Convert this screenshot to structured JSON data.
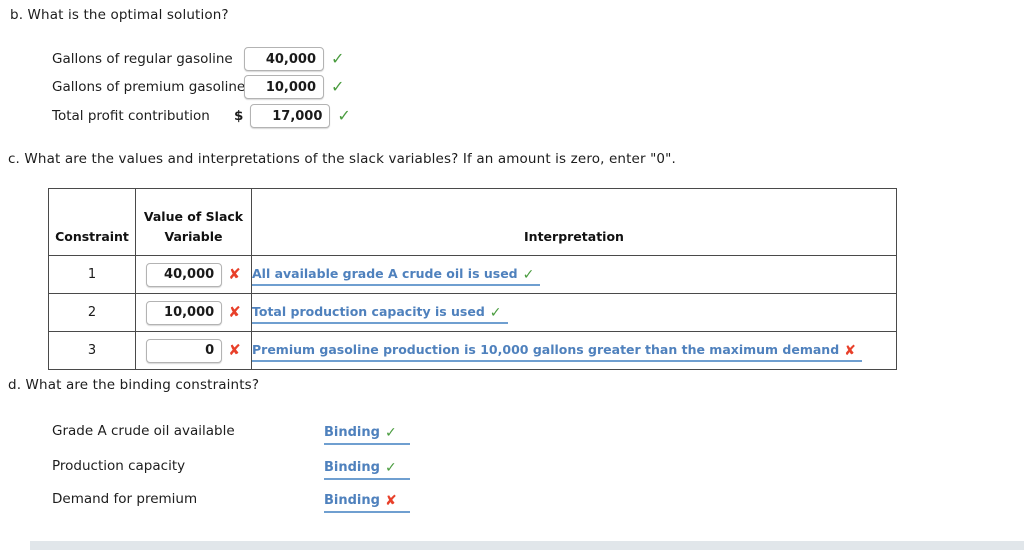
{
  "part_b": {
    "question": "b. What is the optimal solution?",
    "rows": [
      {
        "label": "Gallons of regular gasoline",
        "prefix": "",
        "value": "40,000",
        "mark": "✓",
        "mark_state": "ok"
      },
      {
        "label": "Gallons of premium gasoline",
        "prefix": "",
        "value": "10,000",
        "mark": "✓",
        "mark_state": "ok"
      },
      {
        "label": "Total profit contribution",
        "prefix": "$",
        "value": "17,000",
        "mark": "✓",
        "mark_state": "ok"
      }
    ]
  },
  "part_c": {
    "question": "c. What are the values and interpretations of the slack variables? If an amount is zero, enter \"0\".",
    "table": {
      "headers": {
        "constraint": "Constraint",
        "slack_line1": "Value of Slack",
        "slack_line2": "Variable",
        "interpretation": "Interpretation"
      },
      "rows": [
        {
          "constraint": "1",
          "slack_value": "40,000",
          "slack_mark": "✘",
          "slack_mark_state": "bad",
          "interpretation": "All available grade A crude oil is used",
          "interp_mark": "✓",
          "interp_mark_state": "ok"
        },
        {
          "constraint": "2",
          "slack_value": "10,000",
          "slack_mark": "✘",
          "slack_mark_state": "bad",
          "interpretation": "Total production capacity is used",
          "interp_mark": "✓",
          "interp_mark_state": "ok"
        },
        {
          "constraint": "3",
          "slack_value": "0",
          "slack_mark": "✘",
          "slack_mark_state": "bad",
          "interpretation": "Premium gasoline production is 10,000 gallons greater than the maximum demand",
          "interp_mark": "✘",
          "interp_mark_state": "bad"
        }
      ]
    }
  },
  "part_d": {
    "question": "d. What are the binding constraints?",
    "rows": [
      {
        "label": "Grade A crude oil available",
        "answer": "Binding",
        "mark": "✓",
        "mark_state": "ok"
      },
      {
        "label": "Production capacity",
        "answer": "Binding",
        "mark": "✓",
        "mark_state": "ok"
      },
      {
        "label": "Demand for premium",
        "answer": "Binding",
        "mark": "✘",
        "mark_state": "bad"
      }
    ]
  },
  "colors": {
    "correct_green": "#4a9c3f",
    "incorrect_red": "#e8402a",
    "answer_blue": "#4f81bd",
    "underline_blue": "#6f9fd0",
    "bottom_bar": "#e1e6ea"
  }
}
